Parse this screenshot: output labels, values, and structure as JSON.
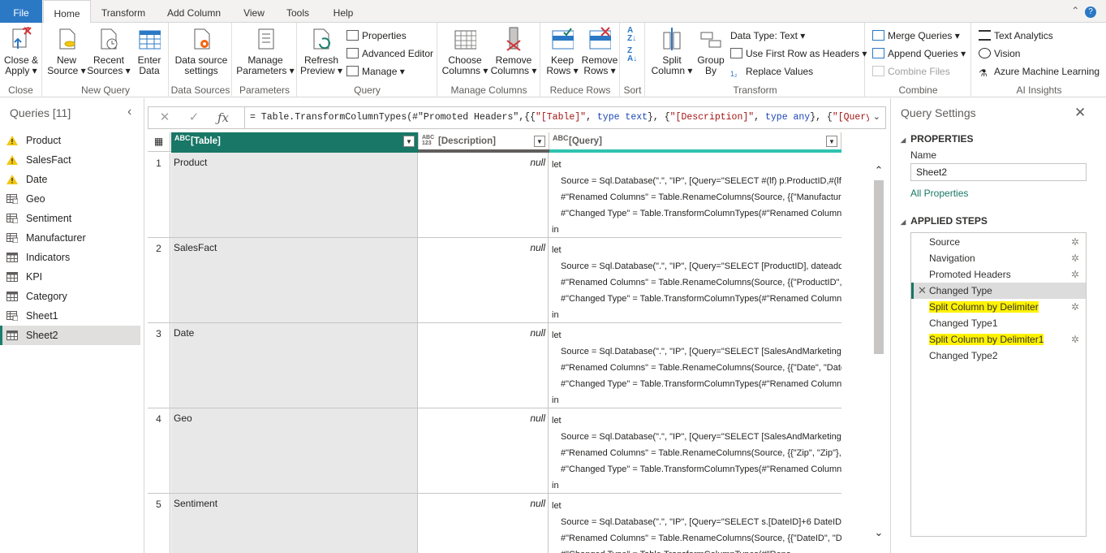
{
  "tabs": [
    "File",
    "Home",
    "Transform",
    "Add Column",
    "View",
    "Tools",
    "Help"
  ],
  "ribbon": {
    "close": {
      "btn": [
        "Close &",
        "Apply"
      ],
      "label": "Close"
    },
    "new_query": {
      "new_source": [
        "New",
        "Source"
      ],
      "recent_sources": [
        "Recent",
        "Sources"
      ],
      "enter_data": [
        "Enter",
        "Data"
      ],
      "label": "New Query"
    },
    "data_sources": {
      "btn": [
        "Data source",
        "settings"
      ],
      "label": "Data Sources"
    },
    "parameters": {
      "btn": [
        "Manage",
        "Parameters"
      ],
      "label": "Parameters"
    },
    "query": {
      "refresh": [
        "Refresh",
        "Preview"
      ],
      "properties": "Properties",
      "advanced_editor": "Advanced Editor",
      "manage": "Manage",
      "label": "Query"
    },
    "manage_columns": {
      "choose": [
        "Choose",
        "Columns"
      ],
      "remove": [
        "Remove",
        "Columns"
      ],
      "label": "Manage Columns"
    },
    "reduce_rows": {
      "keep": [
        "Keep",
        "Rows"
      ],
      "remove": [
        "Remove",
        "Rows"
      ],
      "label": "Reduce Rows"
    },
    "sort": {
      "label": "Sort"
    },
    "transform": {
      "split": [
        "Split",
        "Column"
      ],
      "group": [
        "Group",
        "By"
      ],
      "data_type": "Data Type: Text",
      "first_row": "Use First Row as Headers",
      "replace": "Replace Values",
      "label": "Transform"
    },
    "combine": {
      "merge": "Merge Queries",
      "append": "Append Queries",
      "combine_files": "Combine Files",
      "label": "Combine"
    },
    "ai": {
      "text": "Text Analytics",
      "vision": "Vision",
      "azure": "Azure Machine Learning",
      "label": "AI Insights"
    }
  },
  "queries": {
    "header": "Queries [11]",
    "items": [
      {
        "name": "Product",
        "icon": "warning"
      },
      {
        "name": "SalesFact",
        "icon": "warning"
      },
      {
        "name": "Date",
        "icon": "warning"
      },
      {
        "name": "Geo",
        "icon": "table-param"
      },
      {
        "name": "Sentiment",
        "icon": "table-param"
      },
      {
        "name": "Manufacturer",
        "icon": "table-param"
      },
      {
        "name": "Indicators",
        "icon": "table"
      },
      {
        "name": "KPI",
        "icon": "table"
      },
      {
        "name": "Category",
        "icon": "table"
      },
      {
        "name": "Sheet1",
        "icon": "table-param"
      },
      {
        "name": "Sheet2",
        "icon": "table",
        "selected": true
      }
    ]
  },
  "formula": "= Table.TransformColumnTypes(#\"Promoted Headers\",{{\"[Table]\", type text}, {\"[Description]\", type any}, {\"[Query]\",",
  "columns": [
    {
      "type": "ABC",
      "name": "[Table]"
    },
    {
      "type": "ABC\n123",
      "name": "[Description]"
    },
    {
      "type": "ABC",
      "name": "[Query]"
    }
  ],
  "rows": [
    {
      "n": "1",
      "table": "Product",
      "desc": "null",
      "query": [
        "let",
        "Source = Sql.Database(\".\", \"IP\", [Query=\"SELECT #(lf) p.ProductID,#(lf) p",
        "#\"Renamed Columns\" = Table.RenameColumns(Source, {{\"Manufacture",
        "#\"Changed Type\" = Table.TransformColumnTypes(#\"Renamed Columns",
        "in"
      ]
    },
    {
      "n": "2",
      "table": "SalesFact",
      "desc": "null",
      "query": [
        "let",
        "Source = Sql.Database(\".\", \"IP\", [Query=\"SELECT [ProductID], dateadd(m",
        "#\"Renamed Columns\" = Table.RenameColumns(Source, {{\"ProductID\",",
        "#\"Changed Type\" = Table.TransformColumnTypes(#\"Renamed Columns",
        "in"
      ]
    },
    {
      "n": "3",
      "table": "Date",
      "desc": "null",
      "query": [
        "let",
        "Source = Sql.Database(\".\", \"IP\", [Query=\"SELECT [SalesAndMarketing].[",
        "#\"Renamed Columns\" = Table.RenameColumns(Source, {{\"Date\", \"Date",
        "#\"Changed Type\" = Table.TransformColumnTypes(#\"Renamed Columns",
        "in"
      ]
    },
    {
      "n": "4",
      "table": "Geo",
      "desc": "null",
      "query": [
        "let",
        "Source = Sql.Database(\".\", \"IP\", [Query=\"SELECT [SalesAndMarketing].[",
        "#\"Renamed Columns\" = Table.RenameColumns(Source, {{\"Zip\", \"Zip\"},",
        "#\"Changed Type\" = Table.TransformColumnTypes(#\"Renamed Columns",
        "in"
      ]
    },
    {
      "n": "5",
      "table": "Sentiment",
      "desc": "null",
      "query": [
        "let",
        "Source = Sql.Database(\".\", \"IP\", [Query=\"SELECT s.[DateID]+6 DateID ,s.",
        "#\"Renamed Columns\" = Table.RenameColumns(Source, {{\"DateID\", \"Da",
        "#\"Changed Type\" = Table.TransformColumnTypes(#\"Rena",
        ""
      ]
    }
  ],
  "settings": {
    "title": "Query Settings",
    "properties": "PROPERTIES",
    "name_label": "Name",
    "name_value": "Sheet2",
    "all_properties": "All Properties",
    "applied_steps": "APPLIED STEPS",
    "steps": [
      {
        "name": "Source",
        "gear": true
      },
      {
        "name": "Navigation",
        "gear": true
      },
      {
        "name": "Promoted Headers",
        "gear": true
      },
      {
        "name": "Changed Type",
        "selected": true
      },
      {
        "name": "Split Column by Delimiter",
        "gear": true,
        "highlight": true
      },
      {
        "name": "Changed Type1"
      },
      {
        "name": "Split Column by Delimiter1",
        "gear": true,
        "highlight": true
      },
      {
        "name": "Changed Type2"
      }
    ]
  },
  "colors": {
    "accent": "#187766",
    "file_tab": "#2b78c5",
    "highlight": "#fff200",
    "warning": "#f2c811"
  }
}
